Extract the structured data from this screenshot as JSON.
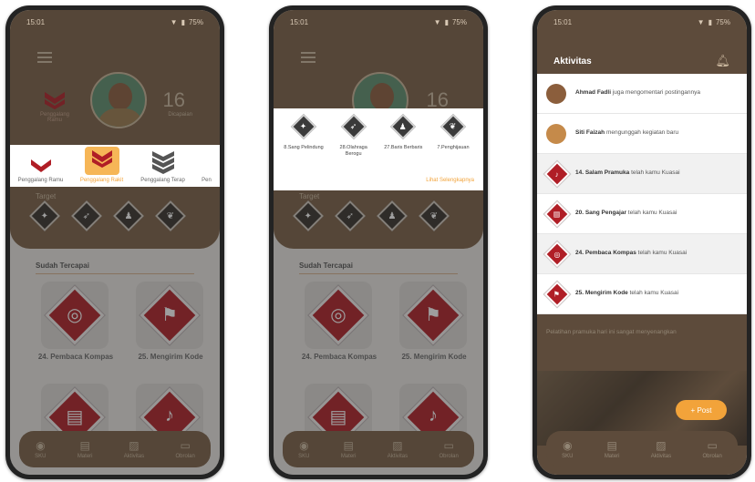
{
  "status": {
    "time": "15:01",
    "battery": "75%"
  },
  "profile": {
    "count": "16",
    "count_label": "Dicapaian",
    "rank_left_label": "Penggalang Ramu"
  },
  "ranks": [
    {
      "label": "Penggalang Ramu"
    },
    {
      "label": "Penggalang Rakit"
    },
    {
      "label": "Penggalang Terap"
    },
    {
      "label": "Pen"
    }
  ],
  "target_label": "Target",
  "sudah_label": "Sudah Tercapai",
  "medals": [
    {
      "label": "24. Pembaca Kompas",
      "icon": "compass-icon"
    },
    {
      "label": "25. Mengirim Kode",
      "icon": "flags-icon"
    }
  ],
  "nav": [
    {
      "label": "SKU",
      "icon": "medal-icon"
    },
    {
      "label": "Materi",
      "icon": "book-icon"
    },
    {
      "label": "Aktivitas",
      "icon": "image-icon"
    },
    {
      "label": "Obrolan",
      "icon": "chat-icon"
    }
  ],
  "popup": {
    "items": [
      {
        "label": "8.Sang Pelindung"
      },
      {
        "label": "28.Olahraga Berogu"
      },
      {
        "label": "27.Baris Berbaris"
      },
      {
        "label": "7.Penghijauan"
      }
    ],
    "more": "Lihat Selengkapnya"
  },
  "activity": {
    "title": "Aktivitas",
    "items": [
      {
        "name": "Ahmad Fadli",
        "text": " juga mengomentari postingannya"
      },
      {
        "name": "Siti Faizah",
        "text": " mengunggah kegiatan baru"
      },
      {
        "name": "14. Salam Pramuka",
        "text": " telah kamu Kuasai"
      },
      {
        "name": "20. Sang Pengajar",
        "text": " telah kamu Kuasai"
      },
      {
        "name": "24. Pembaca Kompas",
        "text": " telah kamu Kuasai"
      },
      {
        "name": "25. Mengirim Kode",
        "text": " telah kamu Kuasai"
      }
    ],
    "post_text": "Pelatihan pramuka hari ini sangat menyenangkan",
    "post_button": "Post"
  }
}
